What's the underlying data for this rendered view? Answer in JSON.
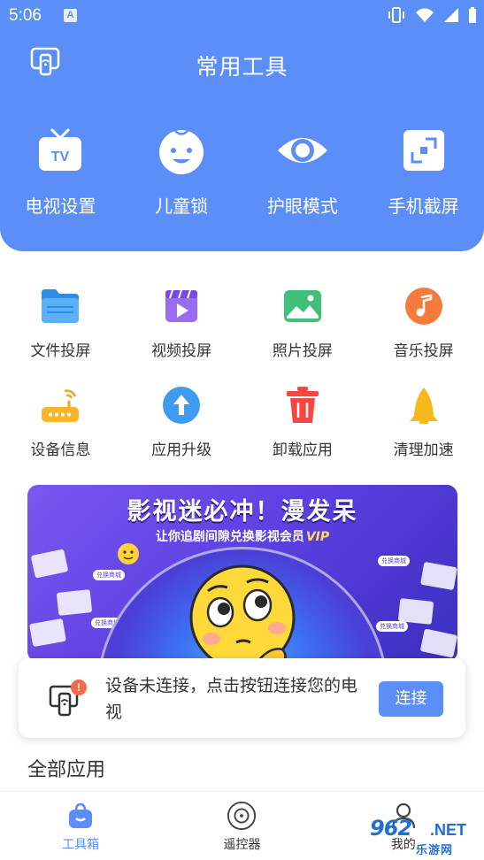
{
  "status_bar": {
    "time": "5:06",
    "notification_glyph": "A"
  },
  "header": {
    "title": "常用工具",
    "tools": [
      {
        "label": "电视设置",
        "icon": "tv-icon"
      },
      {
        "label": "儿童锁",
        "icon": "baby-face-icon"
      },
      {
        "label": "护眼模式",
        "icon": "eye-icon"
      },
      {
        "label": "手机截屏",
        "icon": "screenshot-icon"
      }
    ]
  },
  "grid": {
    "row1": [
      {
        "label": "文件投屏",
        "icon": "folder-icon"
      },
      {
        "label": "视频投屏",
        "icon": "video-icon"
      },
      {
        "label": "照片投屏",
        "icon": "photo-icon"
      },
      {
        "label": "音乐投屏",
        "icon": "music-icon"
      }
    ],
    "row2": [
      {
        "label": "设备信息",
        "icon": "router-icon"
      },
      {
        "label": "应用升级",
        "icon": "upgrade-icon"
      },
      {
        "label": "卸载应用",
        "icon": "trash-icon"
      },
      {
        "label": "清理加速",
        "icon": "rocket-icon"
      }
    ]
  },
  "banner": {
    "title": "影视迷必冲！漫发呆",
    "subtitle": "让你追剧间隙兑换影视会员",
    "vip": "VIP",
    "tag": "兑换商城"
  },
  "connect": {
    "message": "设备未连接，点击按钮连接您的电视",
    "badge": "!",
    "button_label": "连接"
  },
  "section_title": "全部应用",
  "bottom_nav": {
    "items": [
      {
        "label": "工具箱",
        "active": true,
        "icon": "bag-icon"
      },
      {
        "label": "遥控器",
        "active": false,
        "icon": "remote-disc-icon"
      },
      {
        "label": "我的",
        "active": false,
        "icon": "user-icon"
      }
    ]
  },
  "watermark": {
    "number": "962",
    "domain": ".NET",
    "sub": "乐游网"
  },
  "colors": {
    "primary": "#5b8ff7",
    "banner": "#5b3fe0",
    "badge": "#f36b4b"
  }
}
